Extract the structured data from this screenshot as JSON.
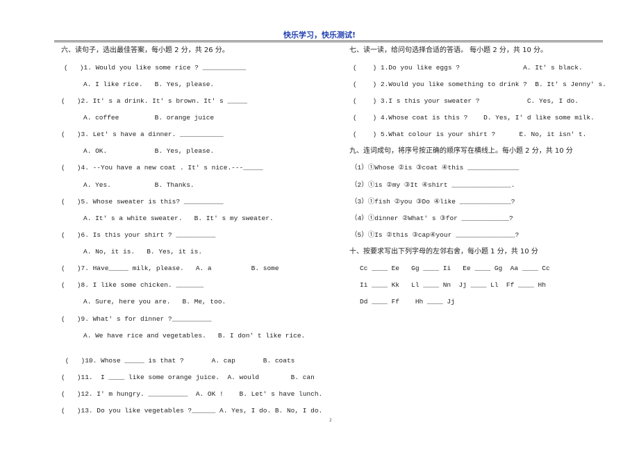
{
  "header": {
    "title": "快乐学习，快乐测试!"
  },
  "left": {
    "section_title": "六、读句子，选出最佳答案，每小题 2 分，共 26 分。",
    "lines": [
      "(   )1. Would you like some rice ? ___________",
      "A. I like rice.   B. Yes, please.",
      "(   )2. It' s a drink. It' s brown. It' s _____",
      "A. coffee         B. orange juice",
      "(   )3. Let' s have a dinner. ___________",
      "A. OK.            B. Yes, please.",
      "(   )4. --You have a new coat . It' s nice.---_____",
      "A. Yes.           B. Thanks.",
      "(   )5. Whose sweater is this? __________",
      "A. It' s a white sweater.   B. It' s my sweater.",
      "(   )6. Is this your shirt ? __________",
      "A. No, it is.   B. Yes, it is.",
      "(   )7. Have_____ milk, please.   A. a          B. some",
      "(   )8. I like some chicken. _______",
      "A. Sure, here you are.   B. Me, too.",
      "(   )9. What' s for dinner ?__________",
      "A. We have rice and vegetables.   B. I don' t like rice.",
      " (   )10. Whose _____ is that ?       A. cap       B. coats",
      "(   )11.  I ____ like some orange juice.  A. would        B. can",
      "(   )12. I' m hungry. __________  A. OK !    B. Let' s have lunch.",
      "(   )13. Do you like vegetables ?______ A. Yes, I do. B. No, I do."
    ]
  },
  "right": {
    "section7_title": "七、读一读，给问句选择合适的答语。 每小题 2 分，共 10 分。",
    "section7_lines": [
      "(    ) 1.Do you like eggs ?                A. It' s black.",
      "(    ) 2.Would you like something to drink ?  B. It' s Jenny' s.",
      "(    ) 3.I s this your sweater ?            C. Yes, I do.",
      "(    ) 4.Whose coat is this ?    D. Yes, I' d like some milk.",
      "(    ) 5.What colour is your shirt ?      E. No, it isn' t."
    ],
    "section9_title": "九、连词成句，将序号按正确的顺序写在横线上。每小题 2 分，共 10 分",
    "section9_lines": [
      "（1）①Whose ②is ③coat ④this _____________",
      "（2）①is ②my ③It ④shirt _______________.",
      "（3）①fish ②you ③Do ④like _____________?",
      "（4）①dinner ②What' s ③for ____________?",
      "（5）①Is ②this ③cap④your _______________?"
    ],
    "section10_title": "十、按要求写出下列字母的左邻右舍，每小题 1 分，共 10 分",
    "section10_lines": [
      "Cc ____ Ee   Gg ____ Ii   Ee ____ Gg  Aa ____ Cc",
      "Ii ____ Kk   Ll ____ Nn  Jj ____ Ll  Ff ____ Hh",
      "Dd ____ Ff    Hh ____ Jj"
    ]
  },
  "footer": {
    "page_number": "2"
  }
}
